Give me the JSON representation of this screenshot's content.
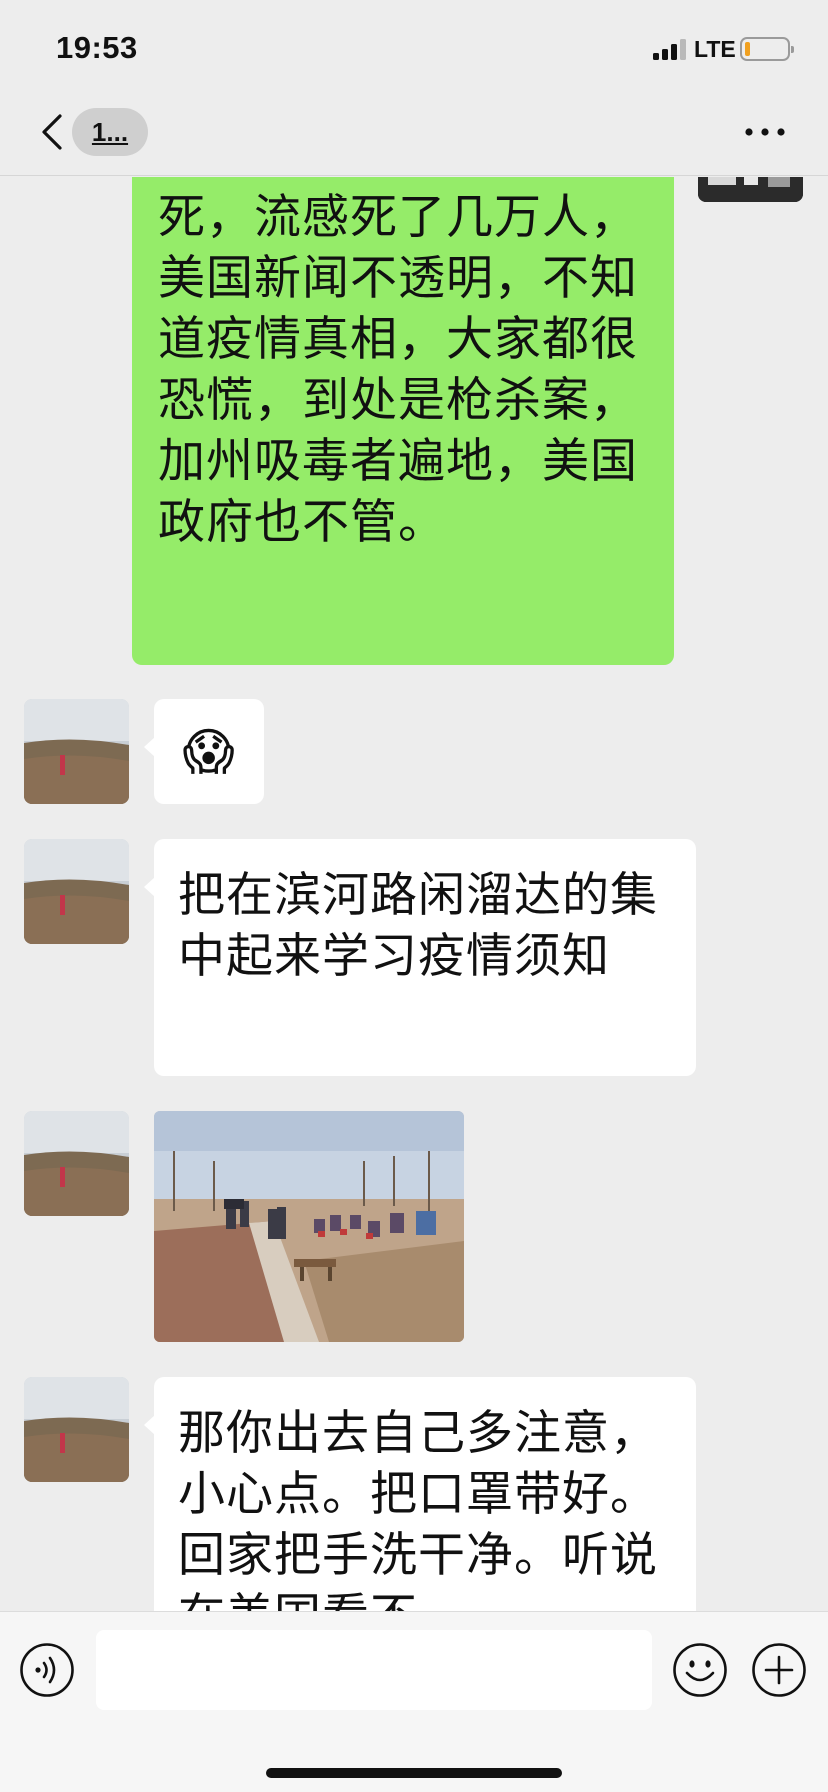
{
  "status_bar": {
    "time": "19:53",
    "network": "LTE",
    "battery_level": 0.12
  },
  "nav": {
    "title": "1...",
    "back_icon": "chevron-left-icon",
    "more_icon": "more-dots-icon"
  },
  "messages": [
    {
      "direction": "sent",
      "type": "text",
      "text": "死，流感死了几万人，美国新闻不透明，不知道疫情真相，大家都很恐慌，到处是枪杀案，加州吸毒者遍地，美国政府也不管。"
    },
    {
      "direction": "received",
      "type": "emoji",
      "text": "😱"
    },
    {
      "direction": "received",
      "type": "text",
      "text": "把在滨河路闲溜达的集中起来学习疫情须知"
    },
    {
      "direction": "received",
      "type": "image",
      "text": ""
    },
    {
      "direction": "received",
      "type": "text",
      "text": "那你出去自己多注意，小心点。把口罩带好。回家把手洗干净。听说在美国看不"
    }
  ],
  "input_bar": {
    "placeholder": "",
    "voice_icon": "voice-icon",
    "emoji_icon": "smiley-icon",
    "plus_icon": "plus-icon"
  },
  "colors": {
    "background": "#ededed",
    "sent_bubble": "#95ec69",
    "received_bubble": "#ffffff"
  }
}
